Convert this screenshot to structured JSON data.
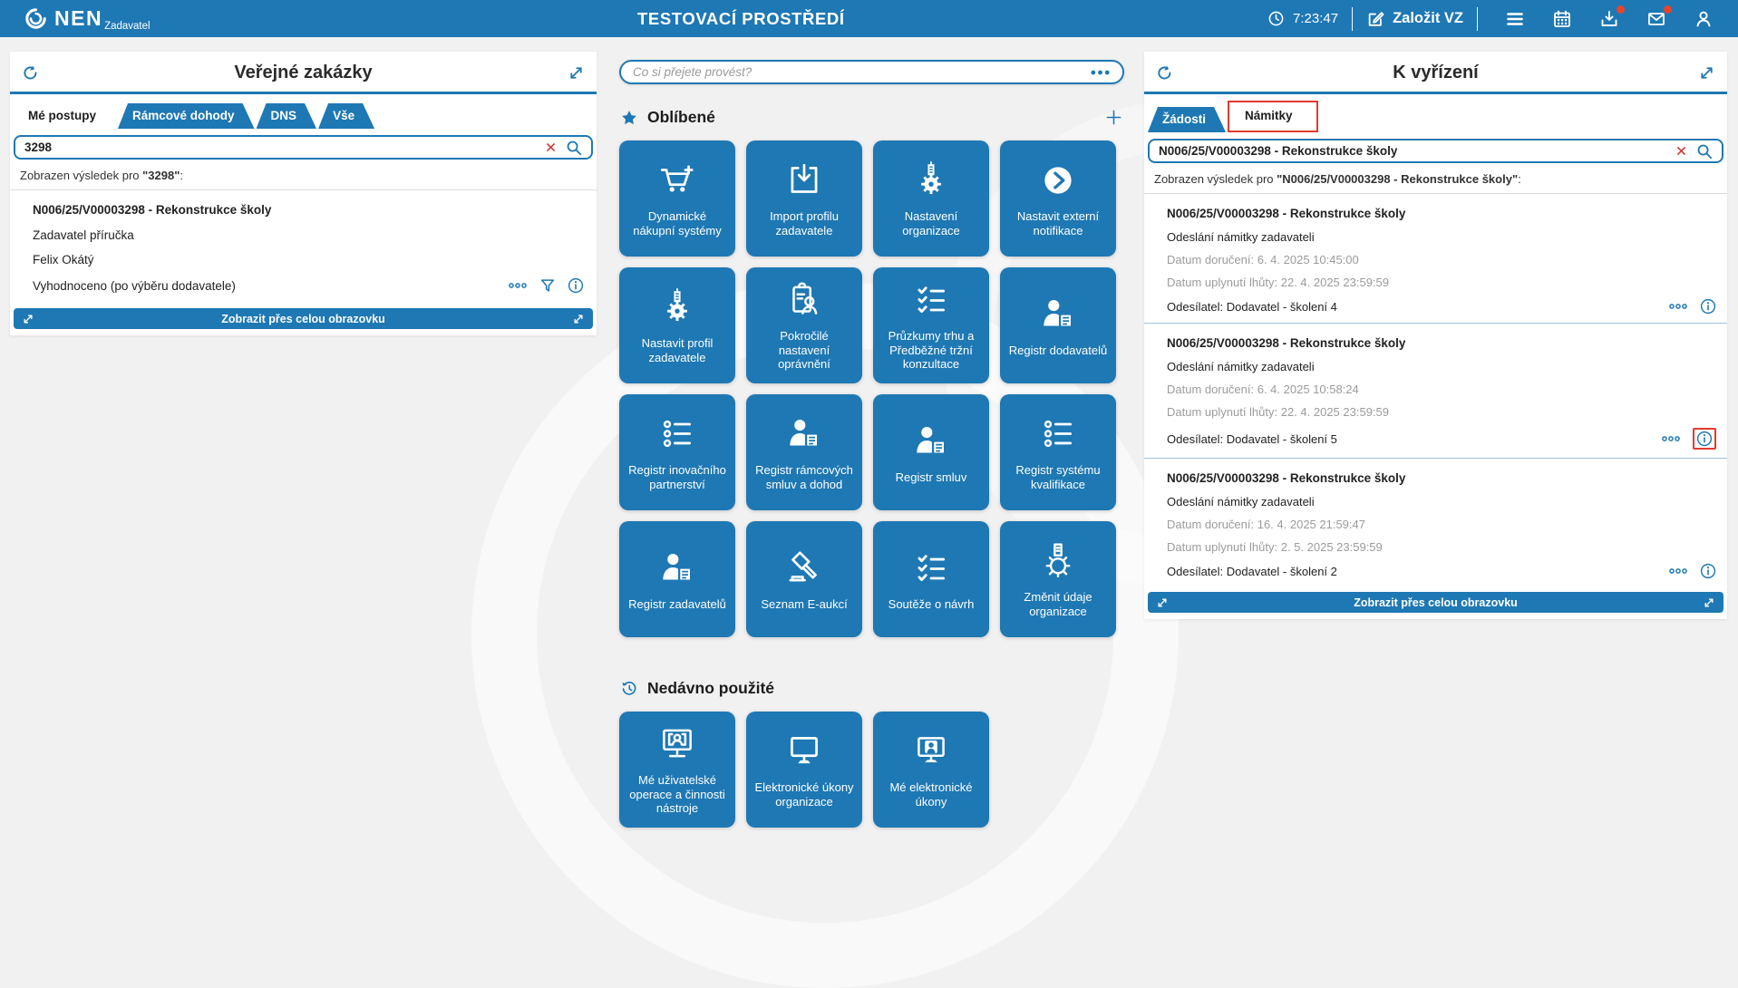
{
  "colors": {
    "primary": "#1e78b4",
    "badge": "#e8432d",
    "highlight": "#e23b30"
  },
  "topbar": {
    "logo_text": "NEN",
    "logo_subtext": "Zadavatel",
    "env_title": "TESTOVACÍ PROSTŘEDÍ",
    "clock": "7:23:47",
    "create_vz_label": "Založit VZ"
  },
  "left_panel": {
    "title": "Veřejné zakázky",
    "tabs": [
      {
        "label": "Mé postupy",
        "active": true
      },
      {
        "label": "Rámcové dohody",
        "active": false
      },
      {
        "label": "DNS",
        "active": false
      },
      {
        "label": "Vše",
        "active": false
      }
    ],
    "search_value": "3298",
    "result_prefix": "Zobrazen výsledek pro ",
    "result_term": "\"3298\"",
    "result_suffix": ":",
    "items": [
      {
        "title": "N006/25/V00003298 - Rekonstrukce školy",
        "lines": [
          "Zadavatel příručka",
          "Felix Okátý"
        ],
        "status": "Vyhodnoceno (po výběru dodavatele)"
      }
    ],
    "fullscreen_label": "Zobrazit přes celou obrazovku"
  },
  "center": {
    "command_placeholder": "Co si přejete provést?",
    "favorites_title": "Oblíbené",
    "favorites": [
      {
        "label": "Dynamické nákupní systémy",
        "icon": "cart-icon"
      },
      {
        "label": "Import profilu zadavatele",
        "icon": "import-icon"
      },
      {
        "label": "Nastavení organizace",
        "icon": "org-gear-icon"
      },
      {
        "label": "Nastavit externí notifikace",
        "icon": "chevron-circle-icon"
      },
      {
        "label": "Nastavit profil zadavatele",
        "icon": "org-gear-icon"
      },
      {
        "label": "Pokročilé nastavení oprávnění",
        "icon": "clipboard-person-icon"
      },
      {
        "label": "Průzkumy trhu a Předběžné tržní konzultace",
        "icon": "checklist-icon"
      },
      {
        "label": "Registr dodavatelů",
        "icon": "person-doc-icon"
      },
      {
        "label": "Registr inovačního partnerství",
        "icon": "bullet-list-icon"
      },
      {
        "label": "Registr rámcových smluv a dohod",
        "icon": "person-doc-icon"
      },
      {
        "label": "Registr smluv",
        "icon": "person-doc-icon"
      },
      {
        "label": "Registr systému kvalifikace",
        "icon": "bullet-list-icon"
      },
      {
        "label": "Registr zadavatelů",
        "icon": "person-doc-icon"
      },
      {
        "label": "Seznam E-aukcí",
        "icon": "gavel-icon"
      },
      {
        "label": "Soutěže o návrh",
        "icon": "checklist-icon"
      },
      {
        "label": "Změnit údaje organizace",
        "icon": "gear-outline-icon"
      }
    ],
    "recent_title": "Nedávno použité",
    "recent": [
      {
        "label": "Mé uživatelské operace a činnosti nástroje",
        "icon": "monitor-user-icon"
      },
      {
        "label": "Elektronické úkony organizace",
        "icon": "monitor-icon"
      },
      {
        "label": "Mé elektronické úkony",
        "icon": "monitor-person-icon"
      }
    ]
  },
  "right_panel": {
    "title": "K vyřízení",
    "tabs": [
      {
        "label": "Žádosti",
        "active": false
      },
      {
        "label": "Námitky",
        "active": true,
        "highlighted": true
      }
    ],
    "search_value": "N006/25/V00003298 - Rekonstrukce školy",
    "result_prefix": "Zobrazen výsledek pro ",
    "result_term": "\"N006/25/V00003298 - Rekonstrukce školy\"",
    "result_suffix": ":",
    "items": [
      {
        "title": "N006/25/V00003298 - Rekonstrukce školy",
        "action": "Odeslání námitky zadavateli",
        "received": "Datum doručení: 6. 4. 2025 10:45:00",
        "deadline": "Datum uplynutí lhůty: 22. 4. 2025 23:59:59",
        "sender": "Odesílatel: Dodavatel - školení 4",
        "info_highlighted": false
      },
      {
        "title": "N006/25/V00003298 - Rekonstrukce školy",
        "action": "Odeslání námitky zadavateli",
        "received": "Datum doručení: 6. 4. 2025 10:58:24",
        "deadline": "Datum uplynutí lhůty: 22. 4. 2025 23:59:59",
        "sender": "Odesílatel: Dodavatel - školení 5",
        "info_highlighted": true
      },
      {
        "title": "N006/25/V00003298 - Rekonstrukce školy",
        "action": "Odeslání námitky zadavateli",
        "received": "Datum doručení: 16. 4. 2025 21:59:47",
        "deadline": "Datum uplynutí lhůty: 2. 5. 2025 23:59:59",
        "sender": "Odesílatel: Dodavatel - školení 2",
        "info_highlighted": false
      }
    ],
    "fullscreen_label": "Zobrazit přes celou obrazovku"
  }
}
